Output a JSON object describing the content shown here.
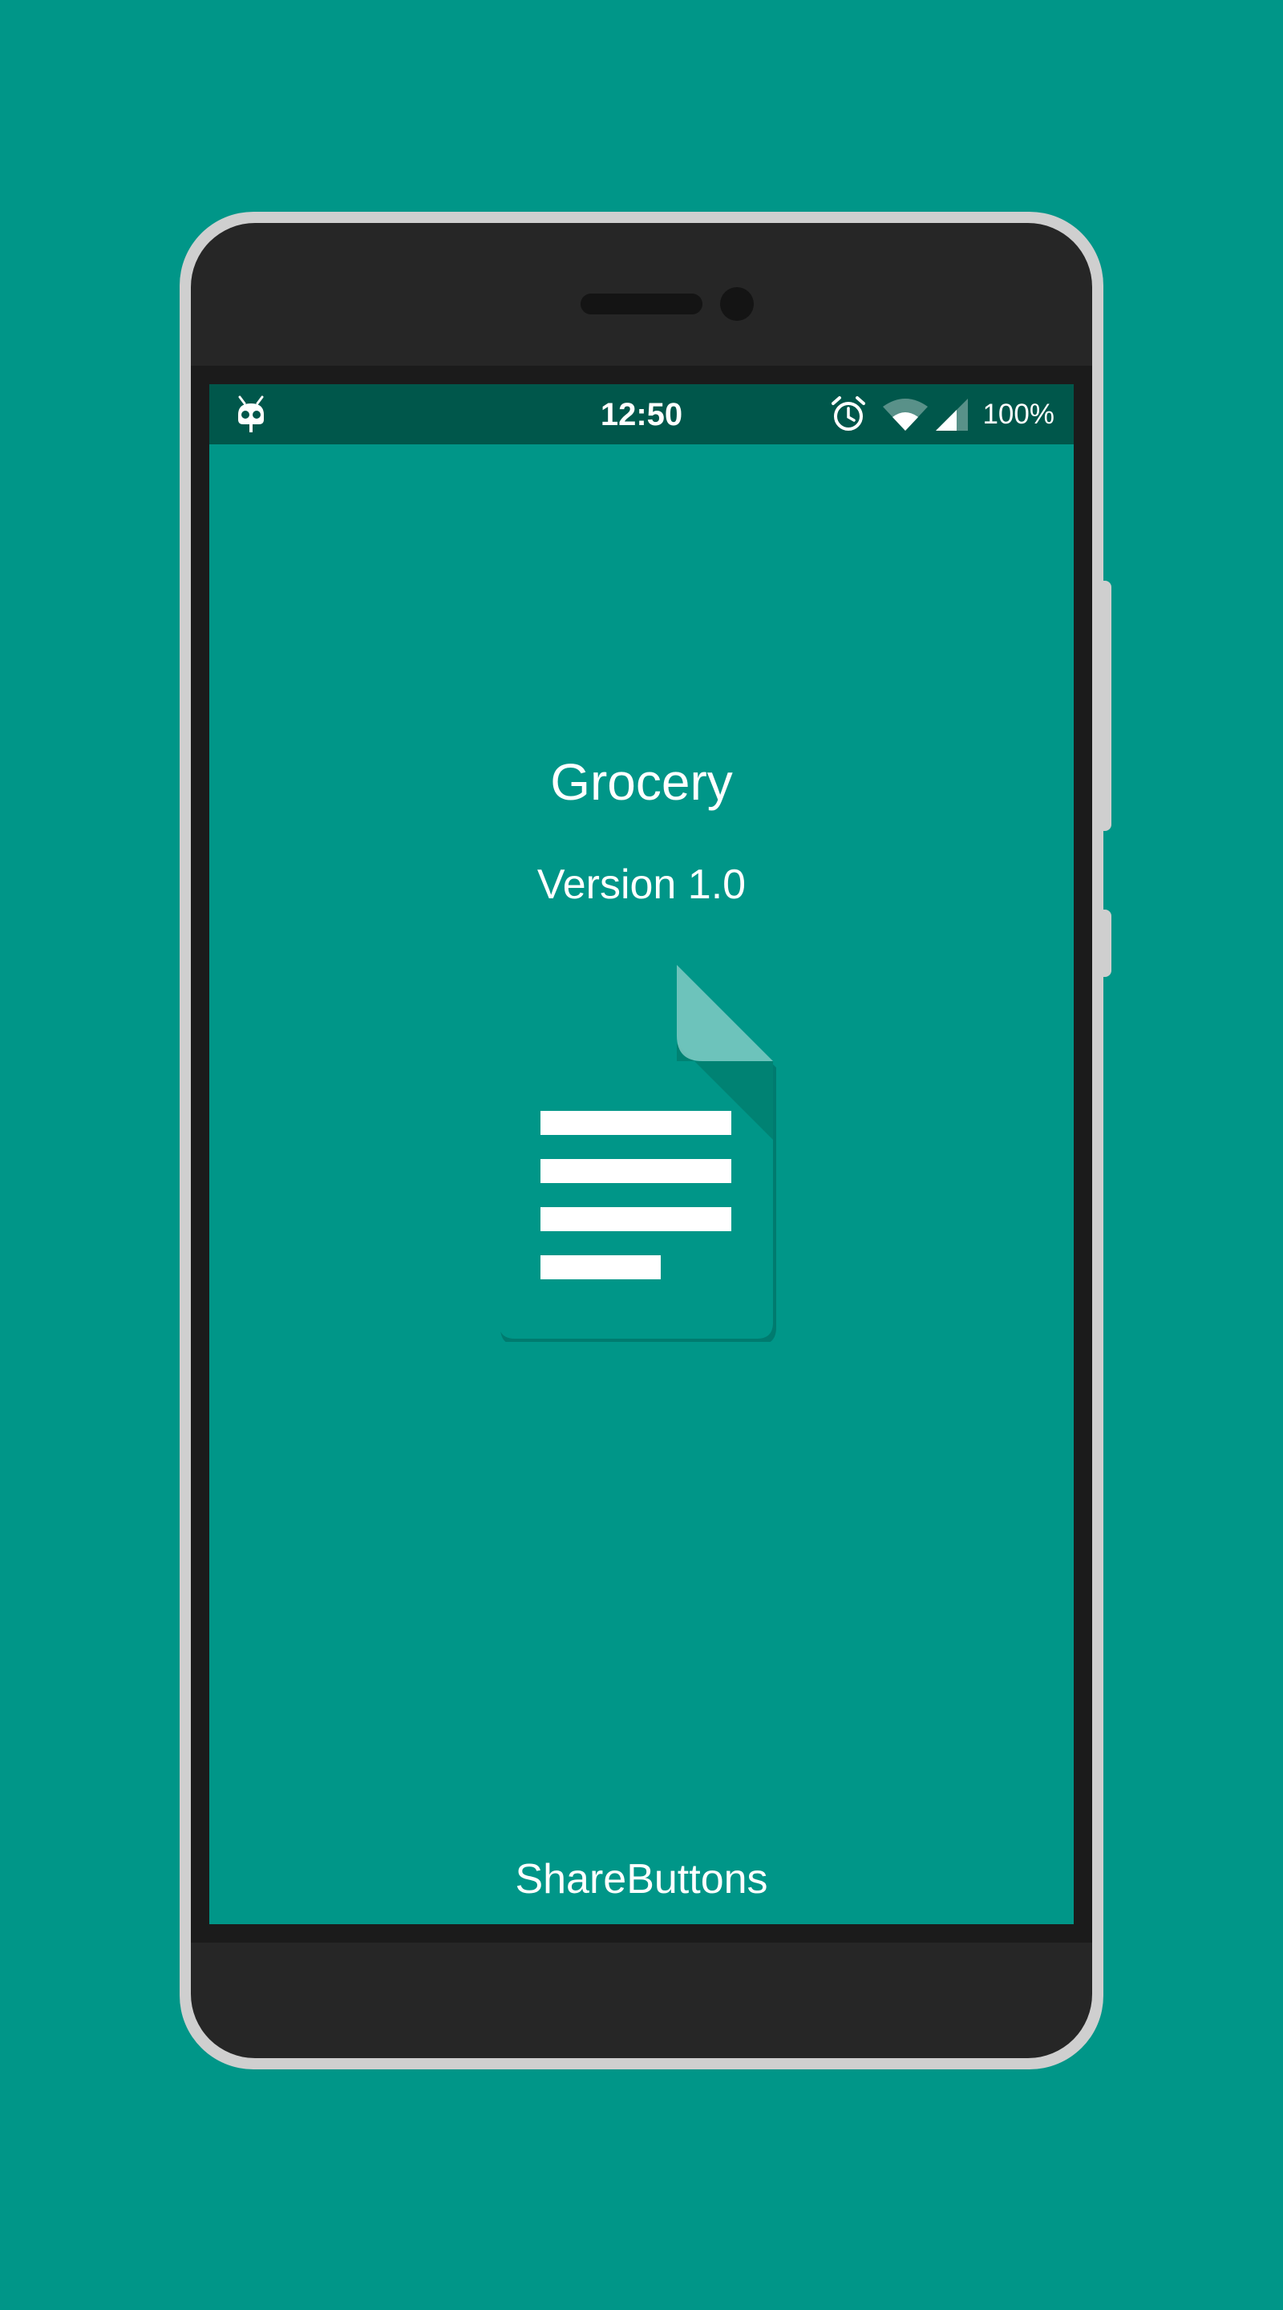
{
  "status_bar": {
    "time": "12:50",
    "battery": "100%",
    "icons": [
      "cyanogenmod-bugdroid-icon",
      "alarm-clock-icon",
      "wifi-icon",
      "cellular-signal-icon"
    ]
  },
  "app": {
    "title": "Grocery",
    "version": "Version 1.0",
    "icon": "document-icon"
  },
  "footer": {
    "label": "ShareButtons"
  },
  "colors": {
    "background": "#009688",
    "status_bar": "#00574b",
    "text": "#ffffff",
    "device_frame": "#cfcfcf",
    "device_body": "#262626"
  }
}
